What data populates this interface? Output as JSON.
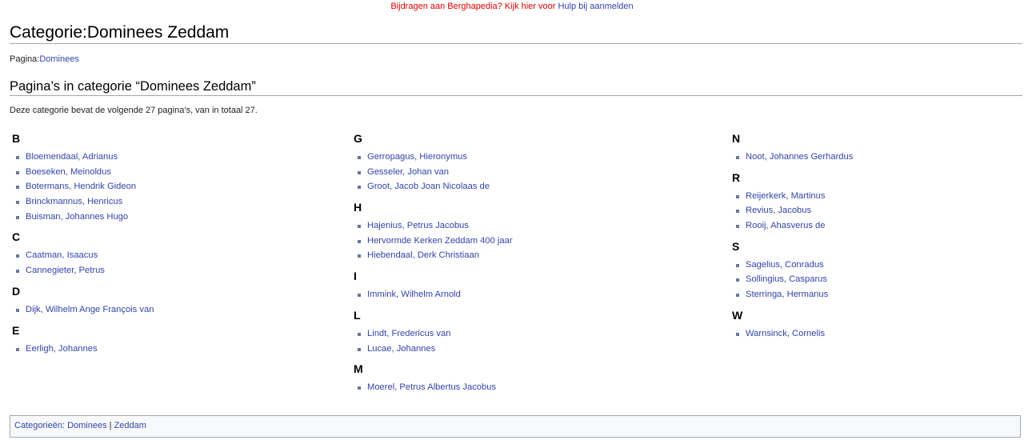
{
  "notice": {
    "text": "Bijdragen aan Berghapedia? Kijk hier voor",
    "link": "Hulp bij aanmelden"
  },
  "title": "Categorie:Dominees Zeddam",
  "pagina": {
    "label": "Pagina:",
    "link": "Dominees"
  },
  "section_heading": "Pagina’s in categorie “Dominees Zeddam”",
  "count_text": "Deze categorie bevat de volgende 27 pagina’s, van in totaal 27.",
  "columns": [
    {
      "groups": [
        {
          "letter": "B",
          "items": [
            "Bloemendaal, Adrianus",
            "Boeseken, Meinoldus",
            "Botermans, Hendrik Gideon",
            "Brinckmannus, Henricus",
            "Buisman, Johannes Hugo"
          ]
        },
        {
          "letter": "C",
          "items": [
            "Caatman, Isaacus",
            "Cannegieter, Petrus"
          ]
        },
        {
          "letter": "D",
          "items": [
            "Dijk, Wilhelm Ange François van"
          ]
        },
        {
          "letter": "E",
          "items": [
            "Eerligh, Johannes"
          ]
        }
      ]
    },
    {
      "groups": [
        {
          "letter": "G",
          "items": [
            "Gerropagus, Hieronymus",
            "Gesseler, Johan van",
            "Groot, Jacob Joan Nicolaas de"
          ]
        },
        {
          "letter": "H",
          "items": [
            "Hajenius, Petrus Jacobus",
            "Hervormde Kerken Zeddam 400 jaar",
            "Hiebendaal, Derk Christiaan"
          ]
        },
        {
          "letter": "I",
          "items": [
            "Immink, Wilhelm Arnold"
          ]
        },
        {
          "letter": "L",
          "items": [
            "Lindt, Fredericus van",
            "Lucae, Johannes"
          ]
        },
        {
          "letter": "M",
          "items": [
            "Moerel, Petrus Albertus Jacobus"
          ]
        }
      ]
    },
    {
      "groups": [
        {
          "letter": "N",
          "items": [
            "Noot, Johannes Gerhardus"
          ]
        },
        {
          "letter": "R",
          "items": [
            "Reijerkerk, Martinus",
            "Revius, Jacobus",
            "Rooij, Ahasverus de"
          ]
        },
        {
          "letter": "S",
          "items": [
            "Sagelius, Conradus",
            "Sollingius, Casparus",
            "Sterringa, Hermanus"
          ]
        },
        {
          "letter": "W",
          "items": [
            "Warnsinck, Cornelis"
          ]
        }
      ]
    }
  ],
  "categories": {
    "label": "Categorieën:",
    "links": [
      "Dominees",
      "Zeddam"
    ],
    "separator": "|"
  }
}
